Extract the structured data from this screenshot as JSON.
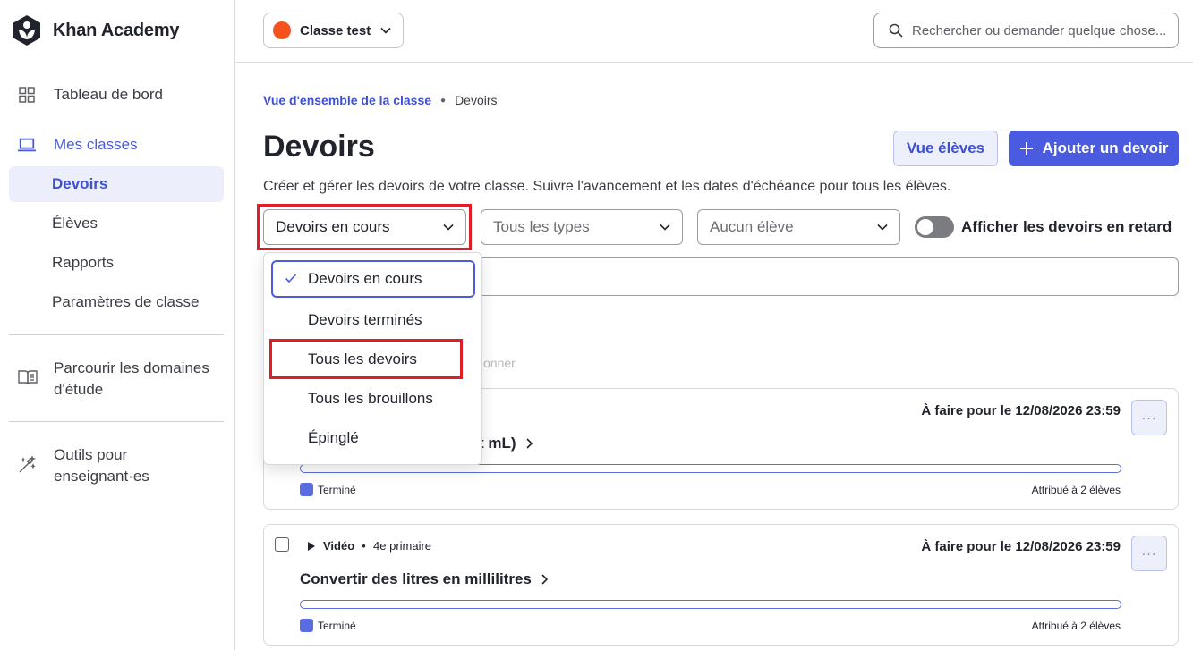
{
  "brand": {
    "name": "Khan Academy"
  },
  "sidebar": {
    "dashboard": "Tableau de bord",
    "my_classes": "Mes classes",
    "sub_items": [
      "Devoirs",
      "Élèves",
      "Rapports",
      "Paramètres de classe"
    ],
    "browse_line1": "Parcourir les domaines",
    "browse_line2": "d'étude",
    "tools_line1": "Outils pour",
    "tools_line2": "enseignant·es"
  },
  "topbar": {
    "class_name": "Classe test",
    "class_color": "#f5521e",
    "search_placeholder": "Rechercher ou demander quelque chose..."
  },
  "breadcrumb": {
    "parent": "Vue d'ensemble de la classe",
    "current": "Devoirs"
  },
  "page": {
    "title": "Devoirs",
    "student_view": "Vue élèves",
    "add_assignment": "Ajouter un devoir",
    "description": "Créer et gérer les devoirs de votre classe. Suivre l'avancement et les dates d'échéance pour tous les élèves."
  },
  "filters": {
    "status": "Devoirs en cours",
    "types": "Tous les types",
    "student": "Aucun élève",
    "late_toggle": "Afficher les devoirs en retard"
  },
  "faded_text": "tionner",
  "dropdown": {
    "options": [
      "Devoirs en cours",
      "Devoirs terminés",
      "Tous les devoirs",
      "Tous les brouillons",
      "Épinglé"
    ],
    "selected_index": 0
  },
  "cards": [
    {
      "due": "À faire pour le 12/08/2026 23:59",
      "title_visible": "t mL)",
      "legend": "Terminé",
      "assigned": "Attribué à 2 élèves"
    },
    {
      "type": "Vidéo",
      "level": "4e primaire",
      "due": "À faire pour le 12/08/2026 23:59",
      "title": "Convertir des litres en millilitres",
      "legend": "Terminé",
      "assigned": "Attribué à 2 élèves"
    }
  ],
  "colors": {
    "accent": "#4a5be0",
    "highlight": "#e01e26"
  }
}
